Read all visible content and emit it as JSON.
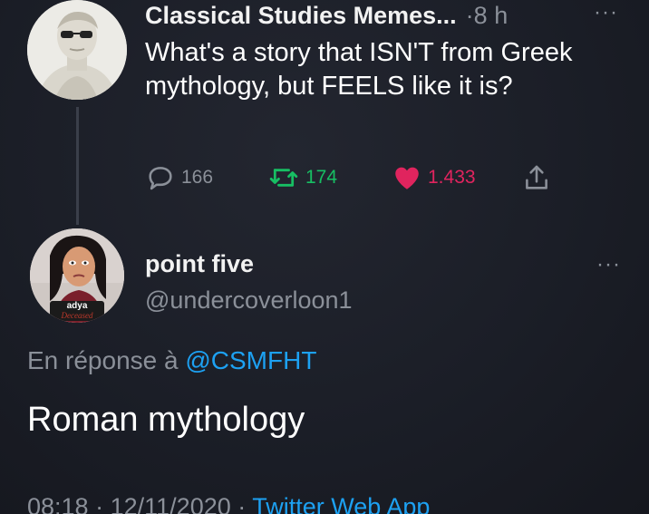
{
  "colors": {
    "background": "#1b1e27",
    "text_primary": "#ffffff",
    "text_secondary": "#8b9099",
    "link_blue": "#1da1f2",
    "retweet_green": "#17bf63",
    "like_red": "#e0245e"
  },
  "original_tweet": {
    "author_name": "Classical Studies Memes...",
    "separator": "·",
    "time": "8 h",
    "more_icon": "more-horizontal-icon",
    "text": "What's a story that ISN'T from Greek mythology, but FEELS like it is?",
    "actions": {
      "replies": "166",
      "retweets": "174",
      "likes": "1.433",
      "reply_icon": "reply-bubble-icon",
      "retweet_icon": "retweet-icon",
      "like_icon": "heart-filled-icon",
      "share_icon": "share-icon"
    },
    "liked": true
  },
  "reply_tweet": {
    "author_name": "point five",
    "handle": "@undercoverloon1",
    "more_icon": "more-horizontal-icon",
    "avatar_badge": {
      "name": "adya",
      "status": "Deceased"
    },
    "replying_to_prefix": "En réponse à",
    "replying_to_handle": "@CSMFHT",
    "text": "Roman mythology",
    "footer": {
      "time": "08:18",
      "separator": "·",
      "date": "12/11/2020",
      "source": "Twitter Web App"
    }
  }
}
